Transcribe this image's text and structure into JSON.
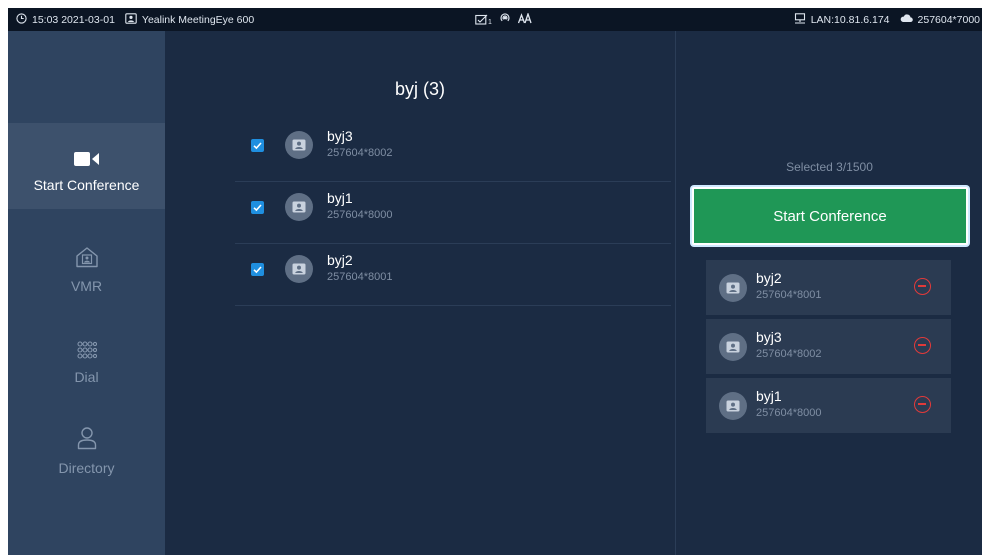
{
  "status_bar": {
    "time": "15:03 2021-03-01",
    "device_name": "Yealink MeetingEye 600",
    "message_badge": "1",
    "lan": "LAN:10.81.6.174",
    "account": "257604*7000"
  },
  "sidebar": {
    "items": [
      {
        "label": "Start Conference",
        "icon": "video-camera-icon",
        "active": true
      },
      {
        "label": "VMR",
        "icon": "vmr-home-icon",
        "active": false
      },
      {
        "label": "Dial",
        "icon": "dialpad-icon",
        "active": false
      },
      {
        "label": "Directory",
        "icon": "person-icon",
        "active": false
      }
    ]
  },
  "group": {
    "title": "byj (3)",
    "contacts": [
      {
        "name": "byj3",
        "number": "257604*8002",
        "checked": true
      },
      {
        "name": "byj1",
        "number": "257604*8000",
        "checked": true
      },
      {
        "name": "byj2",
        "number": "257604*8001",
        "checked": true
      }
    ]
  },
  "selection": {
    "count_text": "Selected 3/1500",
    "start_button": "Start Conference",
    "selected": [
      {
        "name": "byj2",
        "number": "257604*8001"
      },
      {
        "name": "byj3",
        "number": "257604*8002"
      },
      {
        "name": "byj1",
        "number": "257604*8000"
      }
    ]
  },
  "colors": {
    "background": "#1b2b43",
    "sidebar": "#2f4460",
    "sidebar_active": "#3d516c",
    "accent_green": "#1f9756",
    "checkbox_blue": "#1f8fe0",
    "remove_red": "#e23a3a"
  }
}
